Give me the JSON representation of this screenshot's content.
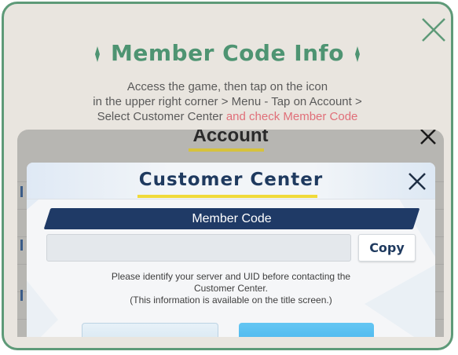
{
  "modal": {
    "title": "Member Code Info",
    "instructions": {
      "line1": "Access the game, then tap on the icon",
      "line2": "in the upper right corner > Menu - Tap on Account >",
      "line3_plain": "Select Customer Center ",
      "line3_highlight": "and check Member Code"
    },
    "colors": {
      "accent": "#4e9472",
      "border": "#5e9a78",
      "highlight": "#e06f79",
      "background": "#e9e5df"
    }
  },
  "screenshot": {
    "account_title": "Account",
    "customer_center": {
      "title": "Customer Center",
      "member_code_label": "Member Code",
      "member_code_value": "",
      "copy_label": "Copy",
      "note": {
        "line1": "Please identify your server and UID before contacting the",
        "line2": "Customer Center.",
        "line3": "(This information is available on the title screen.)"
      }
    }
  }
}
